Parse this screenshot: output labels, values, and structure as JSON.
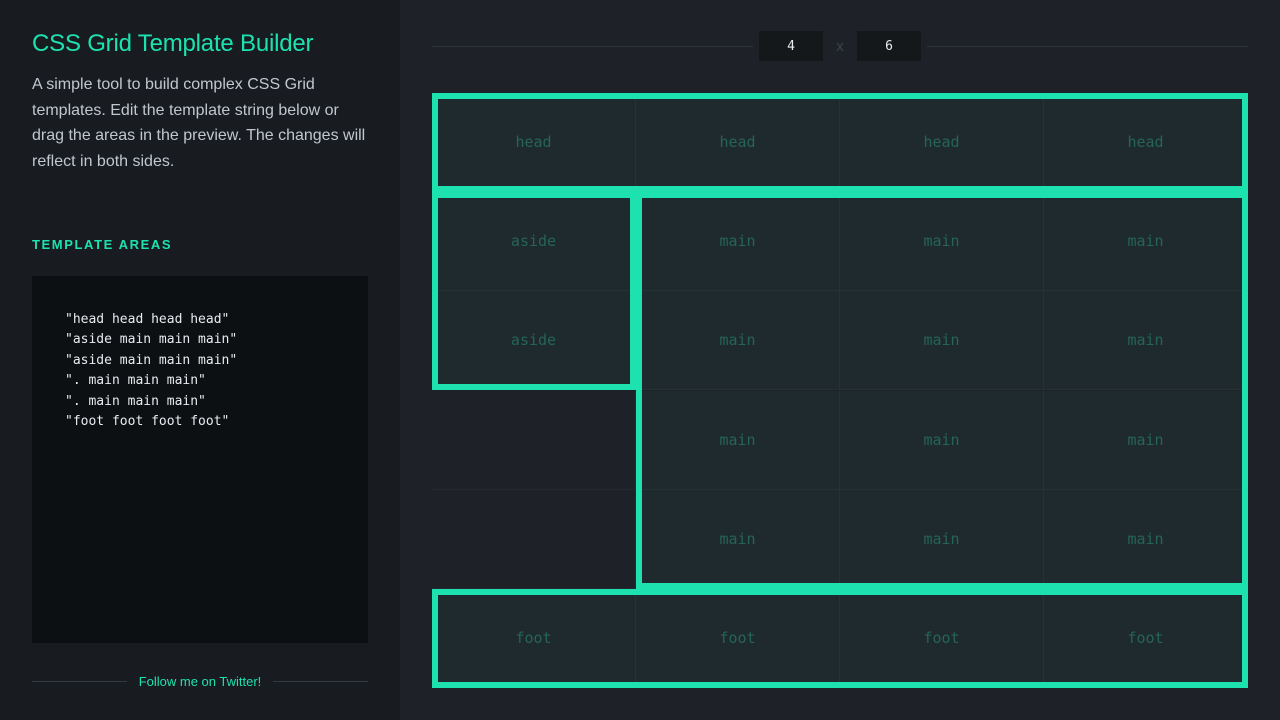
{
  "app": {
    "title": "CSS Grid Template Builder",
    "description": "A simple tool to build complex CSS Grid templates. Edit the template string below or drag the areas in the preview. The changes will reflect in both sides.",
    "section_label": "TEMPLATE AREAS",
    "follow_link": "Follow me on Twitter!"
  },
  "template_lines": [
    "\"head head head head\"",
    "\"aside main main main\"",
    "\"aside main main main\"",
    "\". main main main\"",
    "\". main main main\"",
    "\"foot foot foot foot\""
  ],
  "dimensions": {
    "columns": "4",
    "separator": "x",
    "rows": "6"
  },
  "grid": {
    "columns": 4,
    "rows": 6,
    "cells": [
      [
        "head",
        "head",
        "head",
        "head"
      ],
      [
        "aside",
        "main",
        "main",
        "main"
      ],
      [
        "aside",
        "main",
        "main",
        "main"
      ],
      [
        ".",
        "main",
        "main",
        "main"
      ],
      [
        ".",
        "main",
        "main",
        "main"
      ],
      [
        "foot",
        "foot",
        "foot",
        "foot"
      ]
    ],
    "areas": [
      {
        "name": "head",
        "row_start": 0,
        "row_end": 1,
        "col_start": 0,
        "col_end": 4
      },
      {
        "name": "aside",
        "row_start": 1,
        "row_end": 3,
        "col_start": 0,
        "col_end": 1
      },
      {
        "name": "main",
        "row_start": 1,
        "row_end": 5,
        "col_start": 1,
        "col_end": 4
      },
      {
        "name": "foot",
        "row_start": 5,
        "row_end": 6,
        "col_start": 0,
        "col_end": 4
      }
    ]
  },
  "colors": {
    "accent": "#1de2b0",
    "sidebar_bg": "#181c20",
    "main_bg": "#1e2228",
    "editor_bg": "#0d1013",
    "cell_bg": "#1f2a2f",
    "cell_text": "#256457"
  }
}
